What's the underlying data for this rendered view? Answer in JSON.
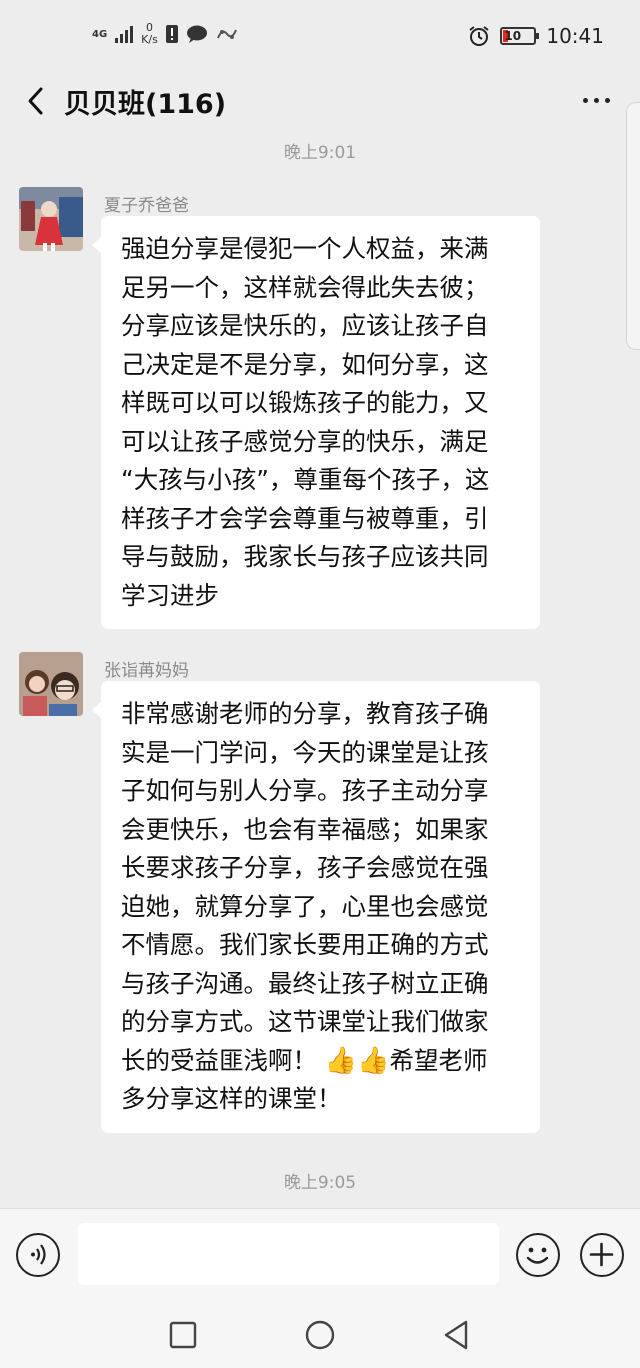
{
  "status_bar": {
    "network": "4G",
    "speed_value": "0",
    "speed_unit": "K/s",
    "battery": "10",
    "time": "10:41",
    "icons": [
      "signal-icon",
      "sim-alert-icon",
      "chat-notification-icon",
      "app-notification-icon",
      "alarm-icon",
      "battery-icon"
    ]
  },
  "header": {
    "title": "贝贝班(116)",
    "back_icon": "chevron-left-icon",
    "more_icon": "more-dots-icon"
  },
  "messages": [
    {
      "timestamp": "晚上9:01",
      "sender": "夏子乔爸爸",
      "text": "强迫分享是侵犯一个人权益，来满\n足另一个，这样就会得此失去彼；\n分享应该是快乐的，应该让孩子自\n己决定是不是分享，如何分享，这\n样既可以可以锻炼孩子的能力，又\n可以让孩子感觉分享的快乐，满足\n“大孩与小孩”，尊重每个孩子，这\n样孩子才会学会尊重与被尊重，引\n导与鼓励，我家长与孩子应该共同\n学习进步"
    },
    {
      "sender": "张诣苒妈妈",
      "text_main": "非常感谢老师的分享，教育孩子确\n实是一门学问，今天的课堂是让孩\n子如何与别人分享。孩子主动分享\n会更快乐，也会有幸福感；如果家\n长要求孩子分享，孩子会感觉在强\n迫她，就算分享了，心里也会感觉\n不情愿。我们家长要用正确的方式\n与孩子沟通。最终让孩子树立正确\n的分享方式。这节课堂让我们做家\n长的受益匪浅啊！",
      "emoji": "👍👍",
      "text_end": "希望老师\n多分享这样的课堂！"
    }
  ],
  "trailing_timestamp": "晚上9:05",
  "input_bar": {
    "voice_icon": "voice-input-icon",
    "text_value": "",
    "emoji_icon": "emoji-smile-icon",
    "plus_icon": "plus-icon"
  },
  "nav_bar": {
    "icons": [
      "recents-square-icon",
      "home-circle-icon",
      "back-triangle-icon"
    ]
  }
}
